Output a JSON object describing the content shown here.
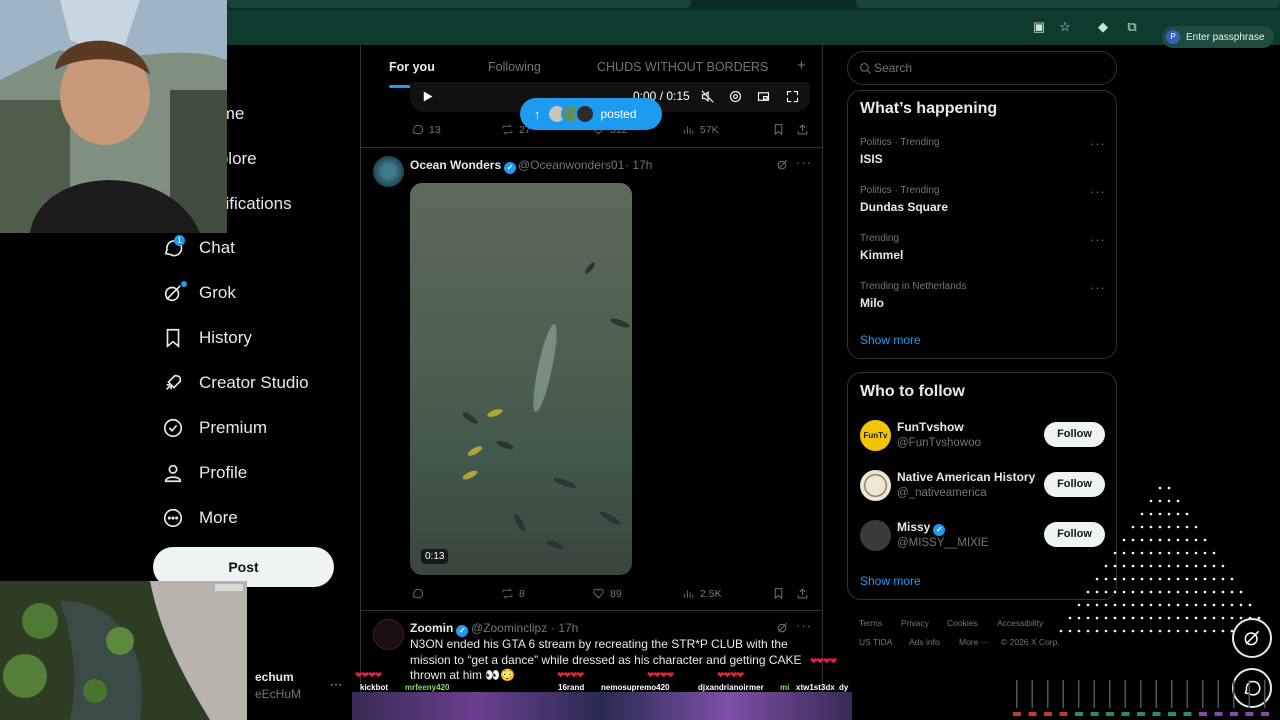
{
  "browser": {
    "profile_initial": "P",
    "profile_label": "Enter passphrase"
  },
  "nav": {
    "home": "Home",
    "explore": "Explore",
    "notifications": "Notifications",
    "chat": "Chat",
    "chat_badge": "1",
    "grok": "Grok",
    "history": "History",
    "creator_studio": "Creator Studio",
    "premium": "Premium",
    "profile": "Profile",
    "more": "More",
    "post": "Post",
    "account_name": "echum",
    "account_handle": "eEcHuM",
    "account_more": "···"
  },
  "feed": {
    "tabs": [
      "For you",
      "Following",
      "CHUDS WITHOUT BORDERS"
    ],
    "add_tab": "+",
    "posted_pill_label": "posted",
    "post1": {
      "video_time": "0:00 / 0:15",
      "replies": "13",
      "reposts": "27",
      "likes": "312",
      "views": "57K"
    },
    "post2": {
      "author": "Ocean Wonders",
      "handle": "@Oceanwonders01",
      "time": "· 17h",
      "video_duration": "0:13",
      "replies": "",
      "reposts": "8",
      "likes": "89",
      "views": "2.5K"
    },
    "post3": {
      "author": "Zoomin",
      "handle": "@Zoominclipz",
      "time": "· 17h",
      "text_line1": "N3ON ended his GTA 6 stream by recreating the STR*P CLUB with the",
      "text_line2": "mission to “get a dance” while dressed as his character and getting CAKE",
      "text_line3": "thrown at him 👀😳"
    }
  },
  "sidebar_right": {
    "search_placeholder": "Search",
    "whats_happening_title": "What’s happening",
    "trends": [
      {
        "category": "Politics · Trending",
        "name": "ISIS"
      },
      {
        "category": "Politics · Trending",
        "name": "Dundas Square"
      },
      {
        "category": "Trending",
        "name": "Kimmel"
      },
      {
        "category": "Trending in Netherlands",
        "name": "Milo"
      }
    ],
    "trend_more": "···",
    "show_more": "Show more",
    "who_to_follow_title": "Who to follow",
    "follow_suggestions": [
      {
        "name": "FunTvshow",
        "handle": "@FunTvshowoo",
        "button": "Follow",
        "avatar_text": "FunTv"
      },
      {
        "name": "Native American History",
        "handle": "@_nativeamerica",
        "button": "Follow"
      },
      {
        "name": "Missy",
        "handle": "@MISSY__MIXIE",
        "button": "Follow",
        "verified": true
      }
    ],
    "footer_links": [
      "Terms",
      "Privacy",
      "Cookies",
      "Accessibility",
      "US TIDA",
      "Ads info",
      "More ···",
      "© 2026 X Corp."
    ]
  },
  "stream_overlay": {
    "chat_names": [
      "kickbot",
      "mrfeeny420",
      "16rand",
      "nemosupremo420",
      "djxandrianoir",
      "mer",
      "mi",
      "xtw1st3dx",
      "dy"
    ],
    "hearts": "❤❤❤❤"
  },
  "colors": {
    "accent": "#1d9bf0",
    "browser_toolbar": "#0f3a30",
    "background": "#000000",
    "text_primary": "#e7e9ea",
    "text_secondary": "#71767b",
    "border": "#2f3336"
  }
}
